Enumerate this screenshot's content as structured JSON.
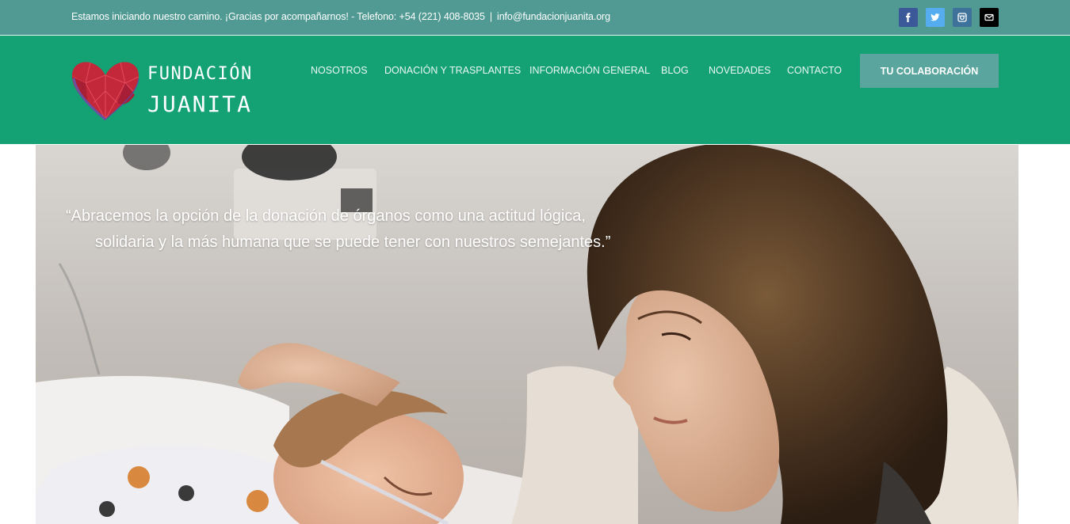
{
  "topbar": {
    "message": "Estamos iniciando nuestro camino. ¡Gracias por acompañarnos! - Telefono: +54 (221) 408-8035",
    "separator": "|",
    "email": "info@fundacionjuanita.org",
    "social": [
      {
        "name": "facebook-icon",
        "color": "#3b5998"
      },
      {
        "name": "twitter-icon",
        "color": "#55acee"
      },
      {
        "name": "instagram-icon",
        "color": "#3f729b"
      },
      {
        "name": "email-icon",
        "color": "#000000"
      }
    ]
  },
  "header": {
    "logo_line1": "FUNDACIÓN",
    "logo_line2": "JUANITA",
    "nav": [
      "NOSOTROS",
      "DONACIÓN Y TRASPLANTES",
      "INFORMACIÓN GENERAL",
      "BLOG",
      "NOVEDADES",
      "CONTACTO"
    ],
    "cta_label": "TU COLABORACIÓN"
  },
  "hero": {
    "quote_line1": "“Abracemos la opción de la donación de órganos como una actitud lógica,",
    "quote_line2": "solidaria y la más humana que se puede tener con nuestros semejantes.”"
  },
  "colors": {
    "topbar_bg": "#519a93",
    "header_bg": "#14a274",
    "cta_bg": "#5aa59d",
    "heart_red": "#c2283a",
    "heart_blue": "#6c4fa0"
  }
}
